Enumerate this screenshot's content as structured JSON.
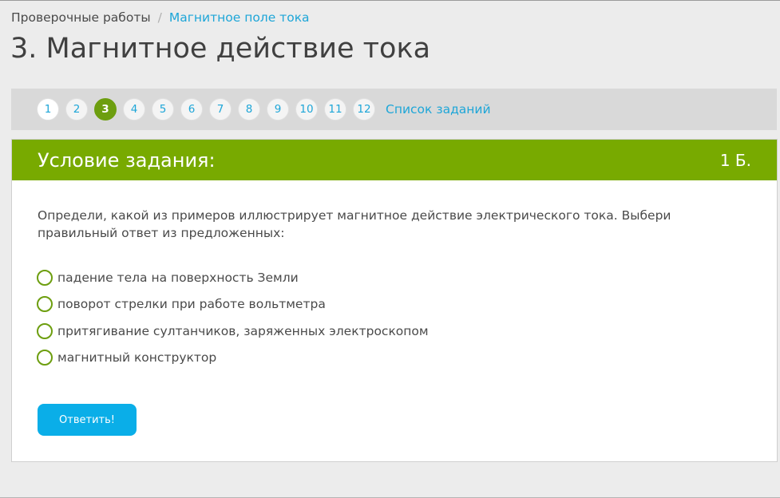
{
  "breadcrumb": {
    "root": "Проверочные работы",
    "separator": "/",
    "current": "Магнитное поле тока"
  },
  "page_title": "3. Магнитное действие тока",
  "task_nav": {
    "items": [
      {
        "label": "1"
      },
      {
        "label": "2"
      },
      {
        "label": "3",
        "active": true
      },
      {
        "label": "4"
      },
      {
        "label": "5"
      },
      {
        "label": "6"
      },
      {
        "label": "7"
      },
      {
        "label": "8"
      },
      {
        "label": "9"
      },
      {
        "label": "10"
      },
      {
        "label": "11"
      },
      {
        "label": "12"
      }
    ],
    "task_list_label": "Список заданий"
  },
  "task": {
    "header_title": "Условие задания:",
    "points": "1 Б.",
    "question": "Определи, какой из примеров иллюстрирует магнитное действие электрического тока. Выбери правильный ответ из предложенных:",
    "options": [
      {
        "label": "падение тела на поверхность Земли"
      },
      {
        "label": "поворот стрелки при работе вольтметра"
      },
      {
        "label": "притягивание султанчиков, заряженных электроскопом"
      },
      {
        "label": "магнитный конструктор"
      }
    ],
    "submit_label": "Ответить!"
  },
  "colors": {
    "accent_green": "#78aa00",
    "active_pill": "#6d9e0f",
    "link_blue": "#1ea6d8",
    "button_blue": "#0aaee8"
  }
}
